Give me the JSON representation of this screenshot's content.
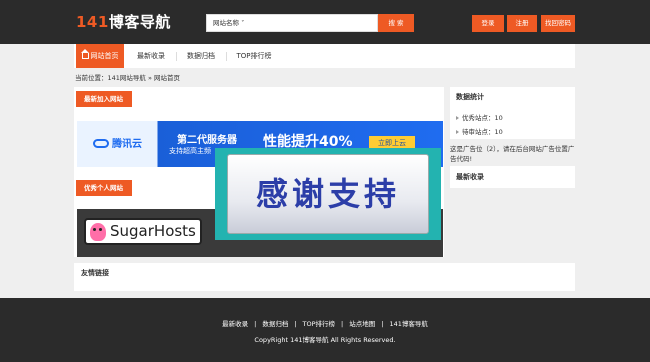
{
  "header": {
    "logo_num": "141",
    "logo_text": "博客导航",
    "search_select": "网站名称",
    "search_button": "搜 索",
    "login": "登录",
    "register": "注册",
    "find_password": "找回密码"
  },
  "nav": {
    "items": [
      {
        "label": "网站首页"
      },
      {
        "label": "最新收录"
      },
      {
        "label": "数据归档"
      },
      {
        "label": "TOP排行榜"
      }
    ]
  },
  "breadcrumb": "当前位置：141网站导航 » 网站首页",
  "main": {
    "newest_title": "最新加入网站",
    "tencent_ad": {
      "logo": "腾讯云",
      "line1": "第二代服务器",
      "line2": "支持超高主频",
      "headline": "性能提升40%",
      "button": "立即上云"
    },
    "overlay_text": "感谢支持",
    "personal_title": "优秀个人网站",
    "sugarhosts": "SugarHosts",
    "links_title": "友情链接"
  },
  "sidebar": {
    "stats_title": "数据统计",
    "stats": [
      {
        "label": "优秀站点：10"
      },
      {
        "label": "待审站点：10"
      }
    ],
    "ad_text": "这是广告位（2），请在后台网站广告位置广告代码!",
    "newest_title": "最新收录"
  },
  "footer": {
    "links": [
      "最新收录",
      "数据归档",
      "TOP排行榜",
      "站点地图",
      "141博客导航"
    ],
    "copyright": "CopyRight 141博客导航 All Rights Reserved."
  },
  "colors": {
    "accent": "#ee5a24",
    "dark": "#2b2b2b",
    "background": "#efefef"
  }
}
